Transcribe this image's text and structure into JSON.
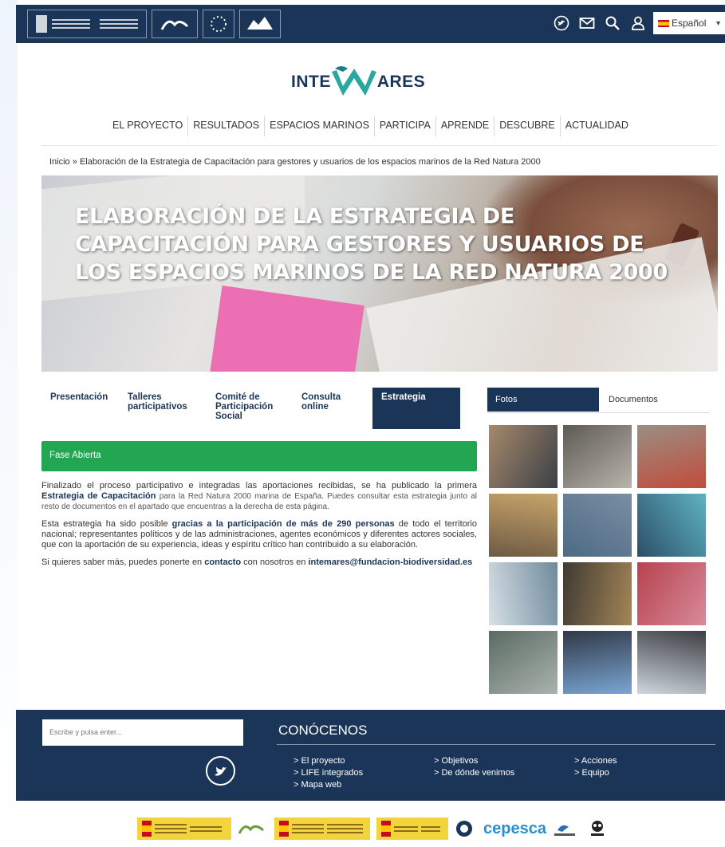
{
  "header": {
    "language": "Español",
    "icons": [
      "twitter-icon",
      "mail-icon",
      "search-icon",
      "user-icon"
    ]
  },
  "brand": {
    "left": "INTE",
    "right": "ARES"
  },
  "nav": [
    "EL PROYECTO",
    "RESULTADOS",
    "ESPACIOS MARINOS",
    "PARTICIPA",
    "APRENDE",
    "DESCUBRE",
    "ACTUALIDAD"
  ],
  "breadcrumb": {
    "home": "Inicio",
    "separator": "»",
    "current": "Elaboración de la Estrategia de Capacitación para gestores y usuarios de los espacios marinos de la Red Natura 2000"
  },
  "hero": {
    "title": "Elaboración de la Estrategia de Capacitación para gestores y usuarios de los espacios marinos de la Red Natura 2000"
  },
  "tabs": [
    {
      "label": "Presentación"
    },
    {
      "label": "Talleres participativos"
    },
    {
      "label": "Comité de Participación Social"
    },
    {
      "label": "Consulta online"
    },
    {
      "label": "Estrategia"
    }
  ],
  "phase": "Fase Abierta",
  "content": {
    "p1_a": "Finalizado el proceso participativo e integradas las aportaciones recibidas, se ha publicado la primera ",
    "p1_b": "Estrategia de Capacitación",
    "p1_c": " para la Red Natura 2000 marina de España. Puedes consultar esta estrategia junto al resto de documentos en el apartado que encuentras a la derecha de esta página.",
    "p2_a": "Esta estrategia ha sido posible ",
    "p2_b": "gracias a la participación de más de 290 personas",
    "p2_c": " de todo el territorio nacional; representantes políticos y de las administraciones,  agentes económicos y diferentes actores sociales, que con la aportación de su experiencia, ideas y espíritu crítico han contribuido a su elaboración.",
    "p3_a": "Si quieres saber más, puedes ponerte en ",
    "p3_link": "contacto",
    "p3_b": " con nosotros en ",
    "p3_email": "intemares@fundacion-biodiversidad.es"
  },
  "side_tabs": {
    "active": "Fotos",
    "other": "Documentos"
  },
  "gallery_colors": [
    [
      "#a6896b",
      "#3b3f47"
    ],
    [
      "#5d5a55",
      "#b9b3ab"
    ],
    [
      "#9a8e83",
      "#c24c3b"
    ],
    [
      "#c8a46a",
      "#6e5a44"
    ],
    [
      "#7a8ea3",
      "#4d6a84"
    ],
    [
      "#5fb3c4",
      "#2c4f68"
    ],
    [
      "#6f8a9c",
      "#d8e0e6"
    ],
    [
      "#a48556",
      "#3f3a33"
    ],
    [
      "#d88a9a",
      "#b7424e"
    ],
    [
      "#aab3ad",
      "#5a6b63"
    ],
    [
      "#7aa6d4",
      "#313847"
    ],
    [
      "#cfd6df",
      "#3b3e42"
    ]
  ],
  "footer": {
    "search_placeholder": "Escribe y pulsa enter...",
    "heading": "CONÓCENOS",
    "col1": [
      "> El proyecto",
      "> LIFE integrados",
      "> Mapa web"
    ],
    "col2": [
      "> Objetivos",
      "> De dónde venimos"
    ],
    "col3": [
      "> Acciones",
      "> Equipo"
    ]
  },
  "partners": {
    "cepesca": "cepesca"
  }
}
